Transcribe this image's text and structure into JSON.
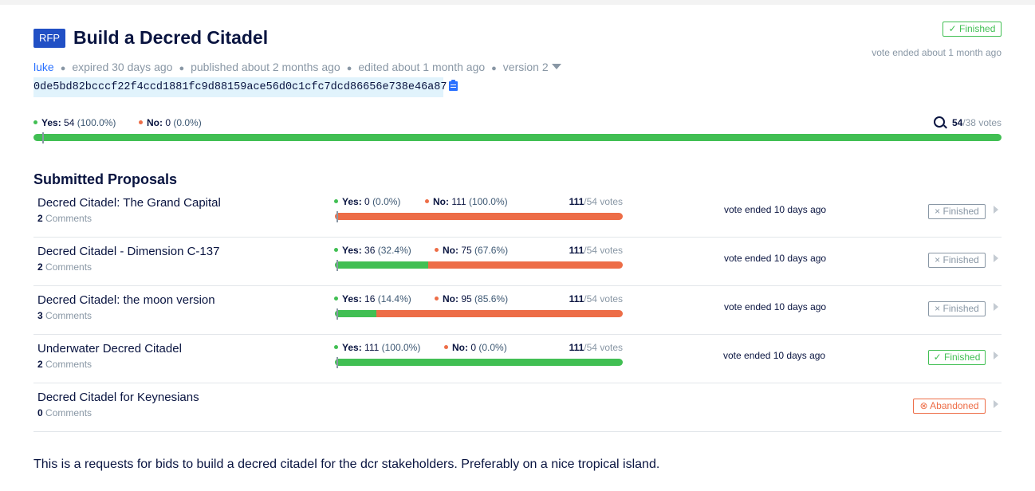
{
  "proposal": {
    "badge": "RFP",
    "title": "Build a Decred Citadel",
    "author": "luke",
    "expired": "expired 30 days ago",
    "published": "published about 2 months ago",
    "edited": "edited about 1 month ago",
    "version": "version 2",
    "token": "0de5bd82bcccf22f4ccd1881fc9d88159ace56d0c1cfc7dcd86656e738e46a87",
    "status": "✓ Finished",
    "vote_ended": "vote ended about 1 month ago",
    "vote": {
      "yes_label": "Yes:",
      "yes": "54",
      "yes_pct": "(100.0%)",
      "no_label": "No:",
      "no": "0",
      "no_pct": "(0.0%)",
      "total": "54",
      "quorum_text": "/38 votes",
      "yes_fraction": 1.0
    }
  },
  "submissions": {
    "heading": "Submitted Proposals",
    "items": [
      {
        "name": "Decred Citadel: The Grand Capital",
        "comments_count": "2",
        "comments_label": "Comments",
        "yes_label": "Yes:",
        "yes": "0",
        "yes_pct": "(0.0%)",
        "no_label": "No:",
        "no": "111",
        "no_pct": "(100.0%)",
        "total": "111",
        "quorum_text": "/54 votes",
        "yes_fraction": 0.0,
        "vote_ended": "vote ended 10 days ago",
        "status": "× Finished"
      },
      {
        "name": "Decred Citadel - Dimension C-137",
        "comments_count": "2",
        "comments_label": "Comments",
        "yes_label": "Yes:",
        "yes": "36",
        "yes_pct": "(32.4%)",
        "no_label": "No:",
        "no": "75",
        "no_pct": "(67.6%)",
        "total": "111",
        "quorum_text": "/54 votes",
        "yes_fraction": 0.324,
        "vote_ended": "vote ended 10 days ago",
        "status": "× Finished"
      },
      {
        "name": "Decred Citadel: the moon version",
        "comments_count": "3",
        "comments_label": "Comments",
        "yes_label": "Yes:",
        "yes": "16",
        "yes_pct": "(14.4%)",
        "no_label": "No:",
        "no": "95",
        "no_pct": "(85.6%)",
        "total": "111",
        "quorum_text": "/54 votes",
        "yes_fraction": 0.144,
        "vote_ended": "vote ended 10 days ago",
        "status": "× Finished"
      },
      {
        "name": "Underwater Decred Citadel",
        "comments_count": "2",
        "comments_label": "Comments",
        "yes_label": "Yes:",
        "yes": "111",
        "yes_pct": "(100.0%)",
        "no_label": "No:",
        "no": "0",
        "no_pct": "(0.0%)",
        "total": "111",
        "quorum_text": "/54 votes",
        "yes_fraction": 1.0,
        "vote_ended": "vote ended 10 days ago",
        "status": "✓ Finished"
      },
      {
        "name": "Decred Citadel for Keynesians",
        "comments_count": "0",
        "comments_label": "Comments",
        "status": "⊗ Abandoned"
      }
    ]
  },
  "description": "This is a requests for bids to build a decred citadel for the dcr stakeholders. Preferably on a nice tropical island.",
  "colors": {
    "yes": "#41bf53",
    "no": "#ed6d47",
    "brand": "#2150c5",
    "link": "#2970ff"
  }
}
